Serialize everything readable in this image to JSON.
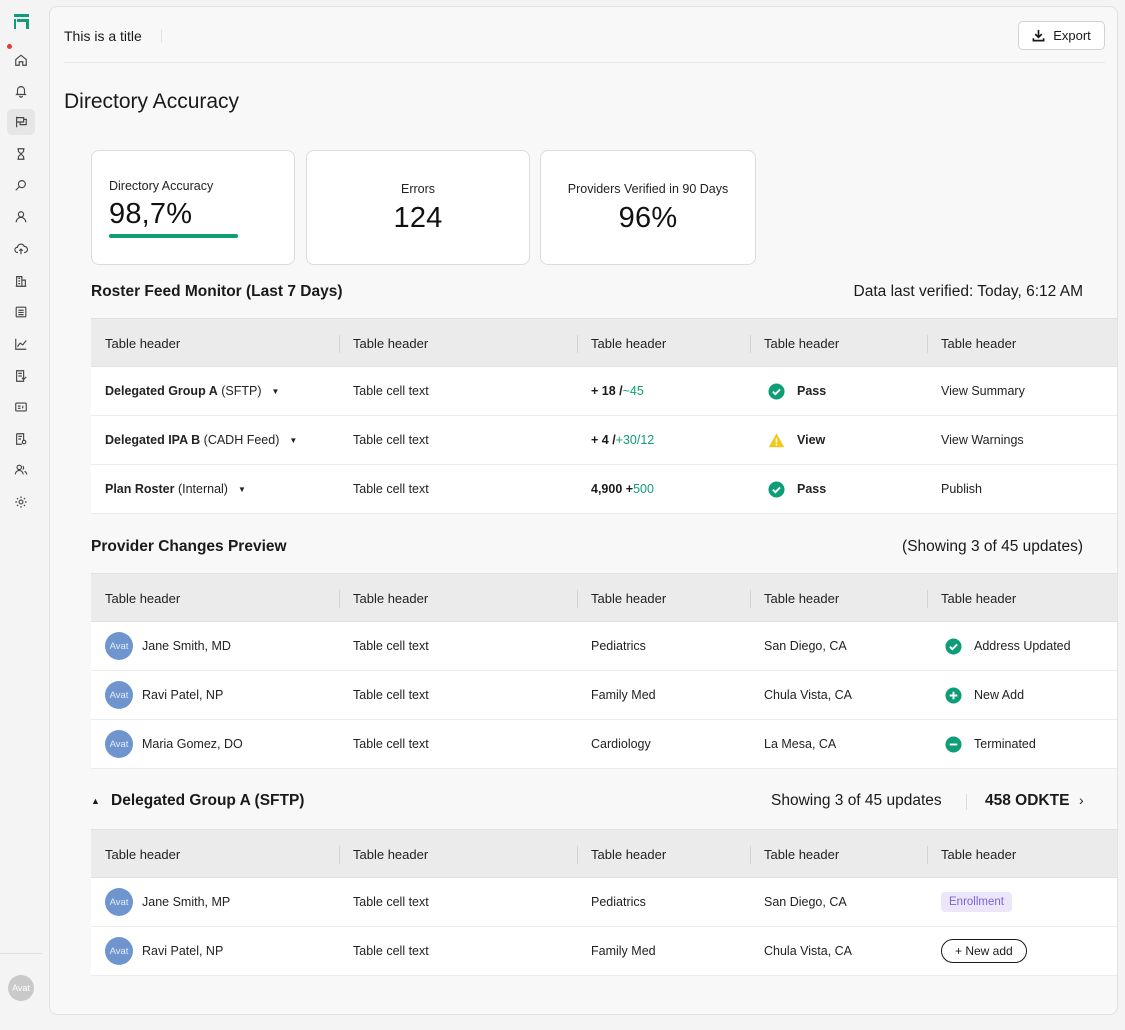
{
  "app": {
    "logo_icon": "app-logo-icon",
    "user_avatar": "Avat"
  },
  "sidebar": {
    "items": [
      {
        "name": "home",
        "icon": "home-icon"
      },
      {
        "name": "notifications",
        "icon": "bell-icon"
      },
      {
        "name": "directory",
        "icon": "flag-icon",
        "active": true
      },
      {
        "name": "pending",
        "icon": "hourglass-icon"
      },
      {
        "name": "search",
        "icon": "search-icon"
      },
      {
        "name": "profile",
        "icon": "user-icon"
      },
      {
        "name": "upload",
        "icon": "cloud-upload-icon"
      },
      {
        "name": "organizations",
        "icon": "building-icon"
      },
      {
        "name": "lists",
        "icon": "list-icon"
      },
      {
        "name": "analytics",
        "icon": "chart-line-icon"
      },
      {
        "name": "documents",
        "icon": "document-icon"
      },
      {
        "name": "id-cards",
        "icon": "id-card-icon"
      },
      {
        "name": "reports",
        "icon": "report-icon"
      },
      {
        "name": "users",
        "icon": "users-icon"
      },
      {
        "name": "settings",
        "icon": "gear-icon"
      }
    ]
  },
  "topbar": {
    "title": "This is a title",
    "export_label": "Export"
  },
  "page": {
    "title": "Directory Accuracy"
  },
  "kpis": [
    {
      "label": "Directory Accuracy",
      "value": "98,7%",
      "progress": 0.987,
      "color": "#0f9d78"
    },
    {
      "label": "Errors",
      "value": "124"
    },
    {
      "label": "Providers Verified in 90 Days",
      "value": "96%"
    }
  ],
  "roster": {
    "title": "Roster Feed Monitor (Last 7 Days)",
    "meta": "Data last verified: Today, 6:12 AM",
    "headers": [
      "Table header",
      "Table header",
      "Table header",
      "Table header",
      "Table header"
    ],
    "rows": [
      {
        "name": "Delegated Group A",
        "source": "(SFTP)",
        "cell": "Table cell text",
        "delta_a": "+ 18 / ",
        "delta_b": "~45",
        "status": "Pass",
        "status_type": "pass",
        "action": "View Summary"
      },
      {
        "name": "Delegated IPA B",
        "source": "(CADH Feed)",
        "cell": "Table cell text",
        "delta_a": "+ 4 / ",
        "delta_b": "+30/12",
        "status": "View",
        "status_type": "warning",
        "action": "View Warnings"
      },
      {
        "name": "Plan Roster",
        "source": "(Internal)",
        "cell": "Table cell text",
        "delta_a": "4,900 + ",
        "delta_b": "500",
        "status": "Pass",
        "status_type": "pass",
        "action": "Publish"
      }
    ]
  },
  "changes": {
    "title": "Provider Changes Preview",
    "meta": "(Showing 3 of 45 updates)",
    "headers": [
      "Table header",
      "Table header",
      "Table header",
      "Table header",
      "Table header"
    ],
    "rows": [
      {
        "avatar": "Avat",
        "name": "Jane Smith, MD",
        "cell": "Table cell text",
        "specialty": "Pediatrics",
        "location": "San Diego, CA",
        "change": "Address Updated",
        "change_type": "check"
      },
      {
        "avatar": "Avat",
        "name": "Ravi Patel, NP",
        "cell": "Table cell text",
        "specialty": "Family Med",
        "location": "Chula Vista, CA",
        "change": "New Add",
        "change_type": "plus"
      },
      {
        "avatar": "Avat",
        "name": "Maria Gomez, DO",
        "cell": "Table cell text",
        "specialty": "Cardiology",
        "location": "La Mesa, CA",
        "change": "Terminated",
        "change_type": "minus"
      }
    ]
  },
  "group": {
    "title": "Delegated Group A (SFTP)",
    "showing": "Showing 3 of 45 updates",
    "count": "458 ODKTE",
    "headers": [
      "Table header",
      "Table header",
      "Table header",
      "Table header",
      "Table header"
    ],
    "rows": [
      {
        "avatar": "Avat",
        "name": "Jane Smith, MP",
        "cell": "Table cell text",
        "specialty": "Pediatrics",
        "location": "San Diego, CA",
        "tag": "Enrollment",
        "tag_type": "chip"
      },
      {
        "avatar": "Avat",
        "name": "Ravi Patel, NP",
        "cell": "Table cell text",
        "specialty": "Family Med",
        "location": "Chula Vista, CA",
        "tag": "+ New add",
        "tag_type": "button"
      }
    ]
  },
  "colors": {
    "accent": "#0f9d78",
    "warning": "#f5c518",
    "avatar": "#6f95cf",
    "chip_bg": "#ece6fb",
    "chip_text": "#7c62d6"
  }
}
